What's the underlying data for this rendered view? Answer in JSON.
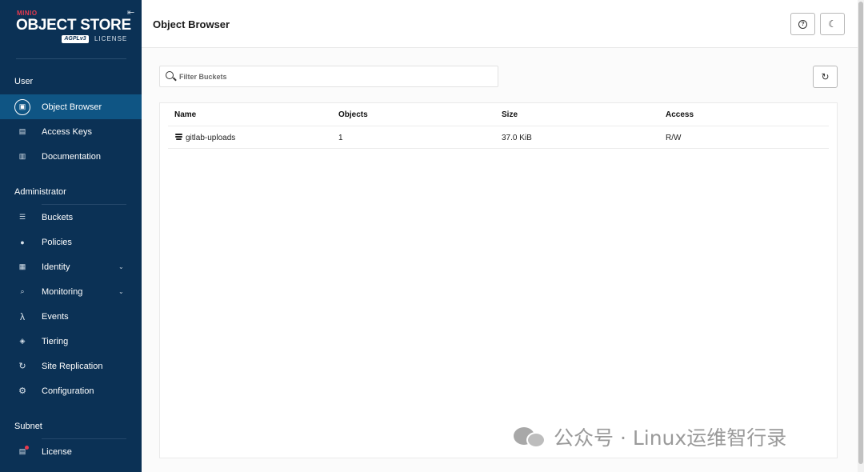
{
  "sidebar": {
    "logo_brand": "MINIO",
    "logo_product": "OBJECT STORE",
    "logo_badge": "AGPLv3",
    "logo_license": "LICENSE",
    "sections": [
      {
        "label": "User"
      },
      {
        "label": "Administrator"
      },
      {
        "label": "Subnet"
      }
    ],
    "items": [
      {
        "label": "Object Browser",
        "icon": "object-browser-icon"
      },
      {
        "label": "Access Keys",
        "icon": "key-icon"
      },
      {
        "label": "Documentation",
        "icon": "document-icon"
      },
      {
        "label": "Buckets",
        "icon": "bucket-icon"
      },
      {
        "label": "Policies",
        "icon": "shield-icon"
      },
      {
        "label": "Identity",
        "icon": "identity-icon"
      },
      {
        "label": "Monitoring",
        "icon": "magnifier-icon"
      },
      {
        "label": "Events",
        "icon": "lambda-icon"
      },
      {
        "label": "Tiering",
        "icon": "layers-icon"
      },
      {
        "label": "Site Replication",
        "icon": "replication-icon"
      },
      {
        "label": "Configuration",
        "icon": "gear-icon"
      },
      {
        "label": "License",
        "icon": "license-icon"
      }
    ]
  },
  "header": {
    "title": "Object Browser"
  },
  "filter": {
    "placeholder": "Filter Buckets"
  },
  "table": {
    "columns": [
      "Name",
      "Objects",
      "Size",
      "Access"
    ],
    "rows": [
      {
        "name": "gitlab-uploads",
        "objects": "1",
        "size": "37.0 KiB",
        "access": "R/W"
      }
    ]
  },
  "watermark": {
    "text": "公众号 · Linux运维智行录"
  },
  "colors": {
    "sidebar_bg": "#0b3155",
    "active_item_bg": "#0f5584",
    "brand_red": "#e8394d"
  }
}
